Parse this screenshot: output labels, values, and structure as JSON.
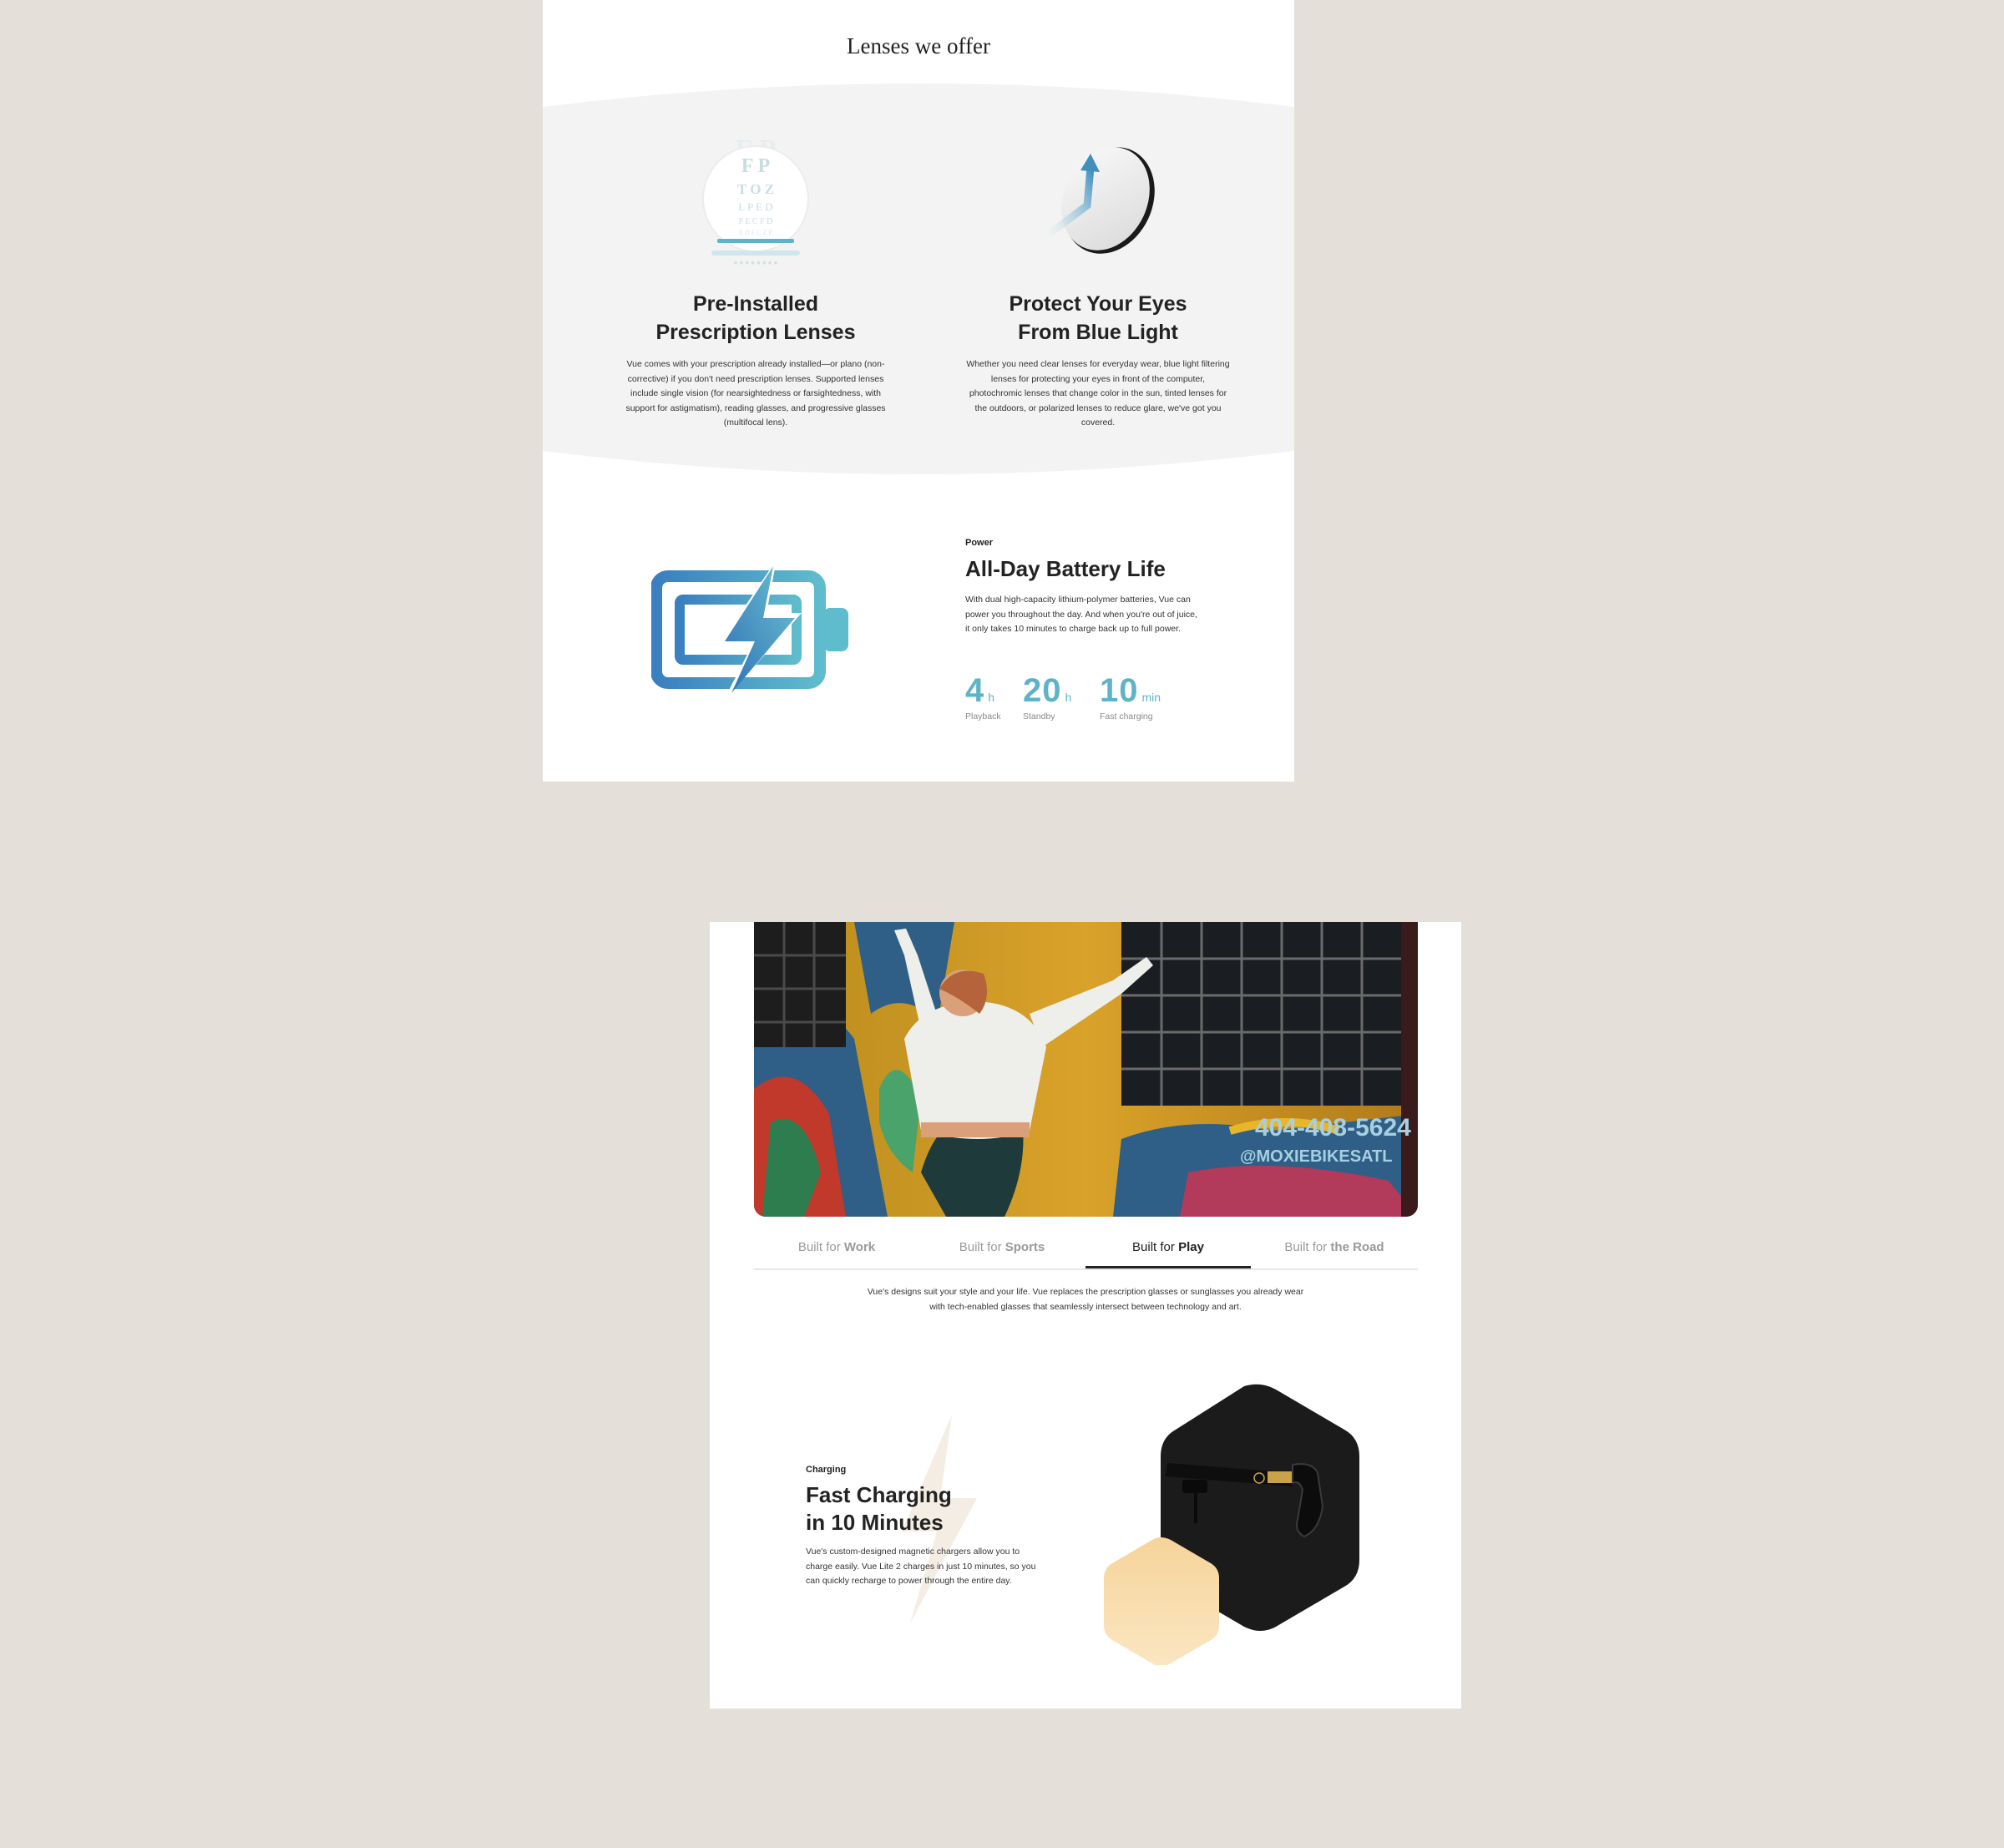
{
  "lenses": {
    "section_title": "Lenses we offer",
    "items": [
      {
        "icon": "eye-chart-icon",
        "title_line1": "Pre-Installed",
        "title_line2": "Prescription Lenses",
        "description": "Vue comes with your prescription already installed—or plano (non-corrective) if you don't need prescription lenses. Supported lenses include single vision (for nearsightedness or farsightedness, with support for astigmatism), reading glasses, and progressive glasses (multifocal lens)."
      },
      {
        "icon": "blue-light-lens-icon",
        "title_line1": "Protect Your Eyes",
        "title_line2": "From Blue Light",
        "description": "Whether you need clear lenses for everyday wear, blue light filtering lenses for protecting your eyes in front of the computer, photochromic lenses that change color in the sun, tinted lenses for the outdoors, or polarized lenses to reduce glare, we've got you covered."
      }
    ],
    "eye_chart_letters": [
      "F P",
      "T O Z",
      "L P E D",
      "P E C F D",
      "E D F C Z P"
    ]
  },
  "power": {
    "eyebrow": "Power",
    "title": "All-Day Battery Life",
    "description": "With dual high-capacity lithium-polymer batteries, Vue can power you throughout the day. And when you're out of juice, it only takes 10 minutes to charge back up to full power.",
    "icon": "battery-charging-icon",
    "stats": [
      {
        "value": "4",
        "unit": "h",
        "label": "Playback"
      },
      {
        "value": "20",
        "unit": "h",
        "label": "Standby"
      },
      {
        "value": "10",
        "unit": "min",
        "label": "Fast charging"
      }
    ]
  },
  "built_for": {
    "photo_text_line1": "404-408-5624",
    "photo_text_line2": "@MOXIEBIKESATL",
    "tabs": [
      {
        "prefix": "Built for ",
        "name": "Work",
        "active": false
      },
      {
        "prefix": "Built for ",
        "name": "Sports",
        "active": false
      },
      {
        "prefix": "Built for ",
        "name": "Play",
        "active": true
      },
      {
        "prefix": "Built for ",
        "name": "the Road",
        "active": false
      }
    ],
    "description": "Vue's designs suit your style and your life. Vue replaces the prescription glasses or sunglasses you already wear with tech-enabled glasses that seamlessly intersect between technology and art."
  },
  "charging": {
    "eyebrow": "Charging",
    "title_line1": "Fast Charging",
    "title_line2": "in 10 Minutes",
    "description": "Vue's custom-designed magnetic chargers allow you to charge easily. Vue Lite 2 charges in just 10 minutes, so you can quickly recharge to power through the entire day.",
    "product_icon": "glasses-charger-icon",
    "accent_dark": "#1b1b1b",
    "accent_gold": "#f6d49a"
  },
  "colors": {
    "page_bg": "#e4dfd8",
    "band_bg": "#f3f3f3",
    "stat_teal": "#5fb3c8",
    "battery_blue": "#3a7fc0"
  }
}
